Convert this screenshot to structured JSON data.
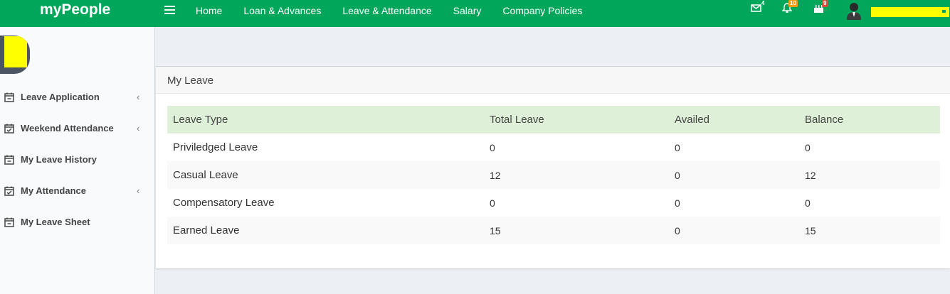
{
  "app": {
    "brand": "myPeople"
  },
  "nav": {
    "items": [
      "Home",
      "Loan & Advances",
      "Leave & Attendance",
      "Salary",
      "Company Policies"
    ]
  },
  "notifications": {
    "messages": {
      "icon": "envelope-icon",
      "count": "4"
    },
    "alerts": {
      "icon": "bell-icon",
      "count": "10"
    },
    "events": {
      "icon": "birthday-cake-icon",
      "count": "9"
    }
  },
  "sidebar": {
    "items": [
      {
        "label": "Leave Application",
        "icon": "calendar-minus-icon",
        "expandable": true
      },
      {
        "label": "Weekend Attendance",
        "icon": "calendar-check-icon",
        "expandable": true
      },
      {
        "label": "My Leave History",
        "icon": "calendar-minus-icon",
        "expandable": false
      },
      {
        "label": "My Attendance",
        "icon": "calendar-check-icon",
        "expandable": true
      },
      {
        "label": "My Leave Sheet",
        "icon": "calendar-minus-icon",
        "expandable": false
      }
    ],
    "chevron": "‹"
  },
  "panel": {
    "title": "My Leave",
    "table": {
      "headers": [
        "Leave Type",
        "Total Leave",
        "Availed",
        "Balance"
      ],
      "rows": [
        [
          "Priviledged Leave",
          "0",
          "0",
          "0"
        ],
        [
          "Casual Leave",
          "12",
          "0",
          "12"
        ],
        [
          "Compensatory Leave",
          "0",
          "0",
          "0"
        ],
        [
          "Earned Leave",
          "15",
          "0",
          "15"
        ]
      ]
    }
  },
  "colors": {
    "header_bg": "#00a65a",
    "table_head_bg": "#dff0d8",
    "badge_orange": "#f39c12",
    "badge_red": "#dd4b39"
  }
}
